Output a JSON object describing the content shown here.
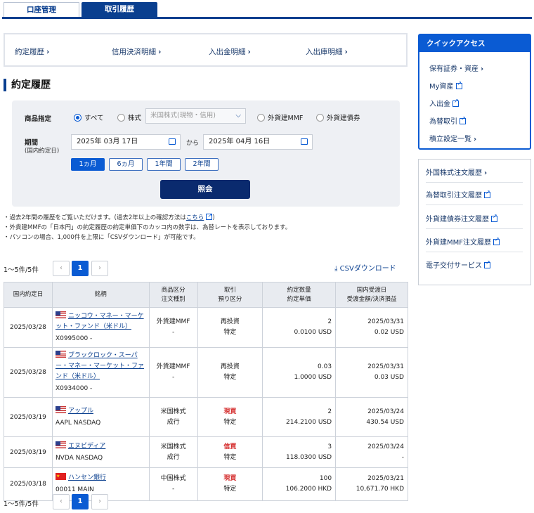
{
  "tabs": [
    {
      "label": "口座管理"
    },
    {
      "label": "取引履歴"
    }
  ],
  "subnav": [
    {
      "label": "約定履歴"
    },
    {
      "label": "信用決済明細"
    },
    {
      "label": "入出金明細"
    },
    {
      "label": "入出庫明細"
    }
  ],
  "section_title": "約定履歴",
  "filter": {
    "product_label": "商品指定",
    "radios": [
      "すべて",
      "株式",
      "外貨建MMF",
      "外貨建債券"
    ],
    "selected_radio": "すべて",
    "stock_select": "米国株式(現物・信用)",
    "period_label": "期間",
    "period_sub": "(国内約定日)",
    "date_from": "2025年 03月 17日",
    "kara": "から",
    "date_to": "2025年 04月 16日",
    "periods": [
      "1ヵ月",
      "6ヵ月",
      "1年間",
      "2年間"
    ],
    "selected_period": "1ヵ月",
    "submit": "照会"
  },
  "notes": {
    "n1_pre": "・過去2年間の履歴をご覧いただけます。(過去2年以上の確認方法は",
    "n1_link": "こちら",
    "n1_post": ")",
    "n2": "・外貨建MMFの「日本円」の約定履歴の約定単価下のカッコ内の数字は、為替レートを表示しております。",
    "n3": "・パソコンの場合、1,000件を上限に「CSVダウンロード」が可能です。"
  },
  "pagination": {
    "count": "1～5件/5件",
    "prev": "‹",
    "page": "1",
    "next": "›"
  },
  "csv": "CSVダウンロード",
  "table": {
    "headers": [
      [
        "国内約定日"
      ],
      [
        "銘柄"
      ],
      [
        "商品区分",
        "注文種別"
      ],
      [
        "取引",
        "預り区分"
      ],
      [
        "約定数量",
        "約定単価"
      ],
      [
        "国内受渡日",
        "受渡金額/決済損益"
      ]
    ],
    "rows": [
      {
        "date": "2025/03/28",
        "flag": "us",
        "name": "ニッコウ・マネー・マーケット・ファンド（米ドル）",
        "code": "X0995000 -",
        "cat": "外貨建MMF",
        "order": "-",
        "trade": "再投資",
        "trade_red": false,
        "acct": "特定",
        "qty": "2",
        "price": "0.0100 USD",
        "settle": "2025/03/31",
        "amount": "0.02 USD"
      },
      {
        "date": "2025/03/28",
        "flag": "us",
        "name": "ブラックロック・スーパー・マネー・マーケット・ファンド（米ドル）",
        "code": "X0934000 -",
        "cat": "外貨建MMF",
        "order": "-",
        "trade": "再投資",
        "trade_red": false,
        "acct": "特定",
        "qty": "0.03",
        "price": "1.0000 USD",
        "settle": "2025/03/31",
        "amount": "0.03 USD"
      },
      {
        "date": "2025/03/19",
        "flag": "us",
        "name": "アップル",
        "code": "AAPL NASDAQ",
        "cat": "米国株式",
        "order": "成行",
        "trade": "現買",
        "trade_red": true,
        "acct": "特定",
        "qty": "2",
        "price": "214.2100 USD",
        "settle": "2025/03/24",
        "amount": "430.54 USD"
      },
      {
        "date": "2025/03/19",
        "flag": "us",
        "name": "エヌビディア",
        "code": "NVDA NASDAQ",
        "cat": "米国株式",
        "order": "成行",
        "trade": "信買",
        "trade_red": true,
        "acct": "特定",
        "qty": "3",
        "price": "118.0300 USD",
        "settle": "2025/03/24",
        "amount": "-"
      },
      {
        "date": "2025/03/18",
        "flag": "cn",
        "name": "ハンセン銀行",
        "code": "00011 MAIN",
        "cat": "中国株式",
        "order": "-",
        "trade": "現買",
        "trade_red": true,
        "acct": "特定",
        "qty": "100",
        "price": "106.2000 HKD",
        "settle": "2025/03/21",
        "amount": "10,671.70 HKD"
      }
    ]
  },
  "quick_access": {
    "title": "クイックアクセス",
    "items": [
      {
        "label": "保有証券・資産",
        "type": "chev"
      },
      {
        "label": "My資産",
        "type": "ext"
      },
      {
        "label": "入出金",
        "type": "ext"
      },
      {
        "label": "為替取引",
        "type": "ext"
      },
      {
        "label": "積立設定一覧",
        "type": "chev"
      }
    ]
  },
  "side_links": [
    {
      "label": "外国株式注文履歴",
      "type": "chev"
    },
    {
      "label": "為替取引注文履歴",
      "type": "ext"
    },
    {
      "label": "外貨建債券注文履歴",
      "type": "ext"
    },
    {
      "label": "外貨建MMF注文履歴",
      "type": "ext"
    },
    {
      "label": "電子交付サービス",
      "type": "ext"
    }
  ],
  "colors": {
    "primary": "#0a3f8f",
    "accent": "#0a5bd3",
    "buy_red": "#d42a2a"
  }
}
